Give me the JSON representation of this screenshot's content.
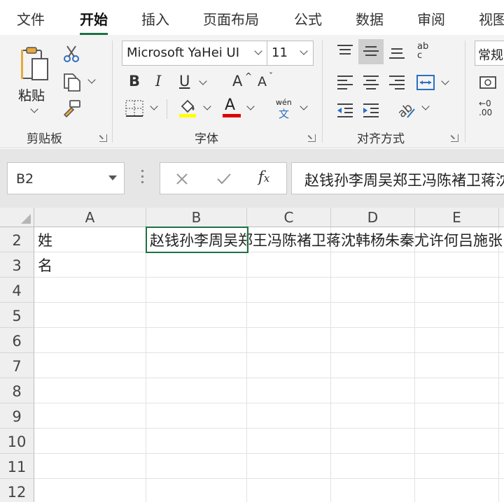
{
  "tabs": [
    {
      "label": "文件",
      "active": false
    },
    {
      "label": "开始",
      "active": true
    },
    {
      "label": "插入",
      "active": false
    },
    {
      "label": "页面布局",
      "active": false
    },
    {
      "label": "公式",
      "active": false
    },
    {
      "label": "数据",
      "active": false
    },
    {
      "label": "审阅",
      "active": false
    },
    {
      "label": "视图",
      "active": false
    }
  ],
  "ribbon": {
    "clipboard": {
      "label": "剪贴板",
      "paste_label": "粘贴"
    },
    "font": {
      "label": "字体",
      "font_name": "Microsoft YaHei UI",
      "font_size": "11",
      "bold": "B",
      "italic": "I",
      "underline": "U",
      "grow": "A",
      "shrink": "A",
      "phonetic_top": "wén",
      "phonetic_bottom": "文",
      "fill_color": "#ffff00",
      "font_color": "#e00000"
    },
    "alignment": {
      "label": "对齐方式",
      "wrap": "ab c",
      "accent": "#1e7145"
    },
    "number": {
      "format": "常规"
    }
  },
  "formula_bar": {
    "name_box": "B2",
    "formula": "赵钱孙李周吴郑王冯陈褚卫蒋沈韩杨朱秦尤许何吕施张"
  },
  "sheet": {
    "columns": [
      "A",
      "B",
      "C",
      "D",
      "E"
    ],
    "rows": [
      "2",
      "3",
      "4",
      "5",
      "6",
      "7",
      "8",
      "9",
      "10",
      "11",
      "12"
    ],
    "cells": {
      "A2": "姓",
      "A3": "名",
      "B2": "赵钱孙李周吴郑王冯陈褚卫蒋沈韩杨朱秦尤许何吕施张"
    },
    "selected": "B2"
  }
}
